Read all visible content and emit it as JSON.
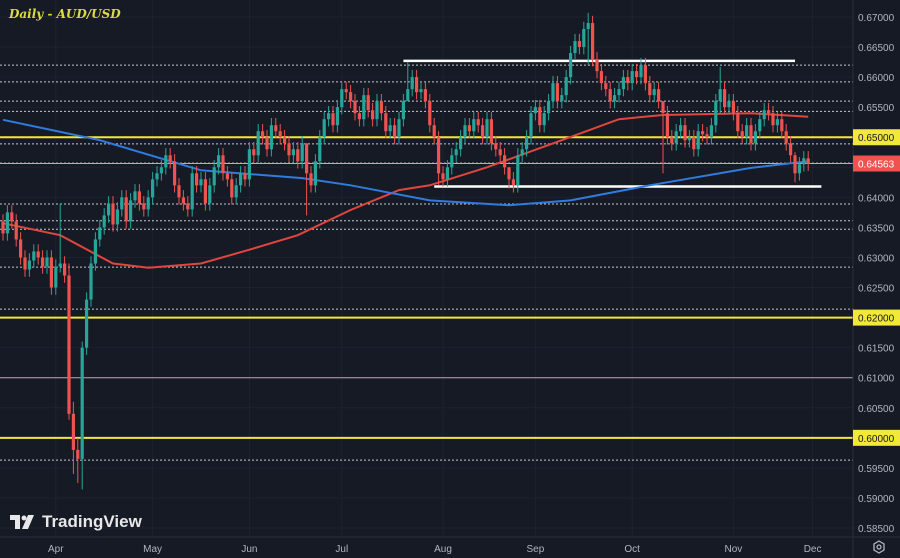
{
  "title": "Daily - AUD/USD",
  "logo_text": "TradingView",
  "colors": {
    "background": "#161a25",
    "grid": "#1e2230",
    "up": "#26a69a",
    "down": "#ef5350",
    "support_resistance": "#f2e83a",
    "range_lines": "#ffffff",
    "ma_fast": "#e0463e",
    "ma_slow": "#2f7be0",
    "axis_text": "#b2b5be",
    "last_price": "#ef5350"
  },
  "chart_data": {
    "type": "candlestick",
    "title": "Daily - AUD/USD",
    "xlabel": "",
    "ylabel": "",
    "ylim": [
      0.585,
      0.67
    ],
    "y_ticks": [
      "0.67000",
      "0.66500",
      "0.66000",
      "0.65500",
      "0.65000",
      "0.64500",
      "0.64000",
      "0.63500",
      "0.63000",
      "0.62500",
      "0.62000",
      "0.61500",
      "0.61000",
      "0.60500",
      "0.60000",
      "0.59500",
      "0.59000",
      "0.58500"
    ],
    "x_ticks": [
      {
        "label": "Apr",
        "index": 12
      },
      {
        "label": "May",
        "index": 34
      },
      {
        "label": "Jun",
        "index": 56
      },
      {
        "label": "Jul",
        "index": 77
      },
      {
        "label": "Aug",
        "index": 100
      },
      {
        "label": "Sep",
        "index": 121
      },
      {
        "label": "Oct",
        "index": 143
      },
      {
        "label": "Nov",
        "index": 166
      },
      {
        "label": "Dec",
        "index": 184
      }
    ],
    "close": [
      0.634,
      0.6375,
      0.636,
      0.633,
      0.63,
      0.628,
      0.6295,
      0.631,
      0.63,
      0.6285,
      0.63,
      0.625,
      0.6285,
      0.629,
      0.627,
      0.604,
      0.598,
      0.5965,
      0.615,
      0.623,
      0.629,
      0.633,
      0.635,
      0.637,
      0.639,
      0.6355,
      0.638,
      0.64,
      0.636,
      0.6395,
      0.641,
      0.639,
      0.638,
      0.64,
      0.643,
      0.644,
      0.645,
      0.647,
      0.646,
      0.642,
      0.64,
      0.639,
      0.638,
      0.644,
      0.642,
      0.643,
      0.639,
      0.642,
      0.645,
      0.647,
      0.644,
      0.643,
      0.64,
      0.642,
      0.644,
      0.643,
      0.648,
      0.647,
      0.651,
      0.65,
      0.648,
      0.652,
      0.651,
      0.65,
      0.649,
      0.647,
      0.648,
      0.646,
      0.649,
      0.644,
      0.642,
      0.646,
      0.65,
      0.653,
      0.654,
      0.652,
      0.655,
      0.658,
      0.6575,
      0.656,
      0.654,
      0.653,
      0.657,
      0.6545,
      0.653,
      0.656,
      0.654,
      0.651,
      0.652,
      0.65,
      0.653,
      0.656,
      0.658,
      0.66,
      0.6575,
      0.658,
      0.656,
      0.652,
      0.65,
      0.644,
      0.643,
      0.645,
      0.647,
      0.648,
      0.65,
      0.652,
      0.651,
      0.653,
      0.652,
      0.65,
      0.653,
      0.649,
      0.648,
      0.647,
      0.645,
      0.643,
      0.642,
      0.647,
      0.648,
      0.65,
      0.654,
      0.655,
      0.652,
      0.654,
      0.656,
      0.659,
      0.656,
      0.657,
      0.66,
      0.664,
      0.666,
      0.665,
      0.668,
      0.669,
      0.663,
      0.661,
      0.659,
      0.658,
      0.656,
      0.657,
      0.658,
      0.66,
      0.659,
      0.661,
      0.66,
      0.662,
      0.659,
      0.657,
      0.658,
      0.656,
      0.654,
      0.65,
      0.649,
      0.651,
      0.652,
      0.6495,
      0.65,
      0.648,
      0.651,
      0.6505,
      0.65,
      0.652,
      0.656,
      0.658,
      0.655,
      0.656,
      0.654,
      0.651,
      0.65,
      0.652,
      0.649,
      0.651,
      0.653,
      0.6545,
      0.654,
      0.652,
      0.653,
      0.651,
      0.649,
      0.647,
      0.644,
      0.6455,
      0.6465,
      0.6456
    ],
    "wick_overrides": {
      "13": [
        0.639,
        0.6275
      ],
      "15": [
        0.629,
        0.603
      ],
      "16": [
        0.606,
        0.594
      ],
      "17": [
        0.6,
        0.5925
      ],
      "18": [
        0.616,
        0.5914
      ],
      "69": [
        0.646,
        0.637
      ],
      "92": [
        0.6625,
        0.657
      ],
      "99": [
        0.651,
        0.642
      ],
      "115": [
        0.645,
        0.6415
      ],
      "133": [
        0.6707,
        0.662
      ],
      "150": [
        0.655,
        0.644
      ],
      "163": [
        0.6617,
        0.654
      ],
      "180": [
        0.6475,
        0.6425
      ]
    },
    "series": [
      {
        "name": "MA fast (red)",
        "points": [
          [
            0,
            0.6357
          ],
          [
            13,
            0.6337
          ],
          [
            25,
            0.629
          ],
          [
            33,
            0.6283
          ],
          [
            45,
            0.629
          ],
          [
            56,
            0.6313
          ],
          [
            67,
            0.6337
          ],
          [
            79,
            0.6379
          ],
          [
            90,
            0.6412
          ],
          [
            97,
            0.642
          ],
          [
            110,
            0.645
          ],
          [
            127,
            0.6495
          ],
          [
            140,
            0.653
          ],
          [
            150,
            0.6537
          ],
          [
            170,
            0.654
          ],
          [
            183,
            0.6534
          ]
        ]
      },
      {
        "name": "MA slow (blue)",
        "points": [
          [
            0,
            0.6529
          ],
          [
            22,
            0.6495
          ],
          [
            45,
            0.6445
          ],
          [
            68,
            0.6432
          ],
          [
            79,
            0.642
          ],
          [
            97,
            0.6395
          ],
          [
            115,
            0.6387
          ],
          [
            129,
            0.6395
          ],
          [
            147,
            0.642
          ],
          [
            170,
            0.6449
          ],
          [
            183,
            0.646
          ]
        ]
      }
    ],
    "horizontal_levels": {
      "yellow": [
        0.65,
        0.62,
        0.6
      ],
      "dotted": [
        0.662,
        0.6592,
        0.656,
        0.6543,
        0.6489,
        0.6457,
        0.6389,
        0.6361,
        0.6347,
        0.6284,
        0.6214,
        0.5963
      ],
      "solid_grey": [
        0.61
      ],
      "white_segments": [
        {
          "price": 0.6627,
          "from": 91,
          "to": 180
        },
        {
          "price": 0.6418,
          "from": 98,
          "to": 186
        }
      ]
    },
    "labels": {
      "yellow": [
        "0.65000",
        "0.62000",
        "0.60000"
      ],
      "last_price": "0.64563"
    },
    "last_price": 0.64563
  }
}
